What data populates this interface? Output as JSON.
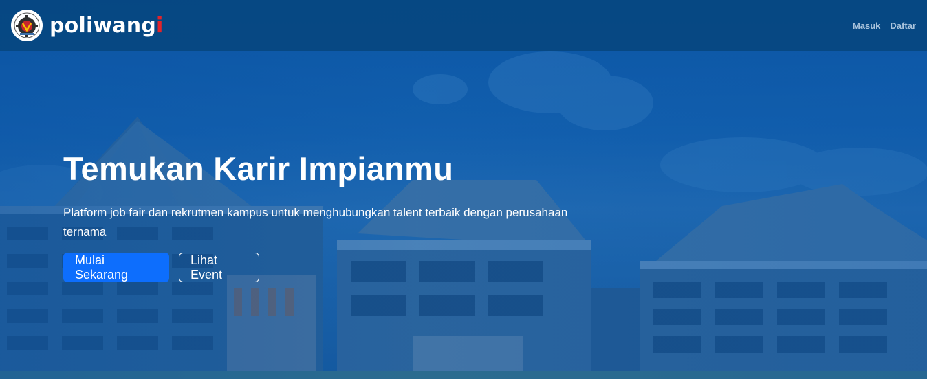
{
  "brand": {
    "name_main": "poliwang",
    "name_accent": "i",
    "logo_icon": "poliwangi-gear-emblem-icon"
  },
  "nav": {
    "links": [
      {
        "label": "Masuk"
      },
      {
        "label": "Daftar"
      }
    ]
  },
  "hero": {
    "title": "Temukan Karir Impianmu",
    "subtitle": "Platform job fair dan rekrutmen kampus untuk menghubungkan talent terbaik dengan perusahaan ternama",
    "primary_button": "Mulai Sekarang",
    "secondary_button": "Lihat Event"
  },
  "colors": {
    "navbar": "#064680",
    "primary": "#0d6efd",
    "brand_accent": "#e3242b",
    "nav_link": "#a9c3dc"
  }
}
